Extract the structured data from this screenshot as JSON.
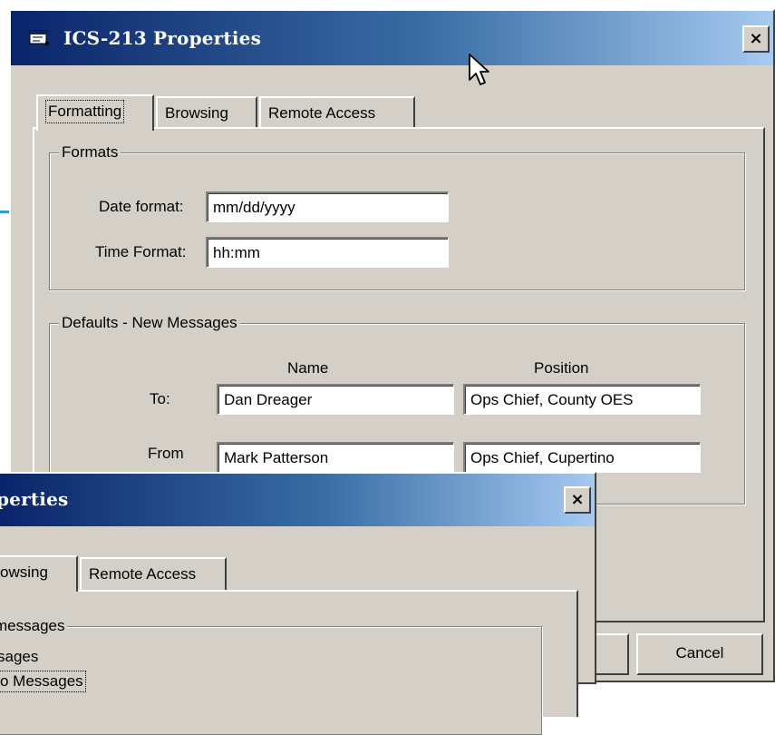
{
  "main_window": {
    "title": "ICS-213 Properties",
    "close_label": "×",
    "tabs": [
      {
        "label": "Formatting",
        "active": true
      },
      {
        "label": "Browsing",
        "active": false
      },
      {
        "label": "Remote Access",
        "active": false
      }
    ],
    "formats_group": {
      "legend": "Formats",
      "date_label": "Date format:",
      "date_value": "mm/dd/yyyy",
      "time_label": "Time Format:",
      "time_value": "hh:mm"
    },
    "defaults_group": {
      "legend": "Defaults - New Messages",
      "col_name": "Name",
      "col_position": "Position",
      "to_label": "To:",
      "to_name": "Dan Dreager",
      "to_position": "Ops Chief, County OES",
      "from_label": "From",
      "from_name": "Mark Patterson",
      "from_position": "Ops Chief, Cupertino"
    },
    "cancel_label": "Cancel"
  },
  "second_window": {
    "title": "perties",
    "close_label": "×",
    "tabs": [
      {
        "label": "owsing",
        "active": true
      },
      {
        "label": "Remote Access",
        "active": false
      }
    ],
    "group_legend": "messages",
    "item_1": "sages",
    "item_2": "o Messages"
  },
  "icons": {
    "app": "window-app-icon",
    "close": "close-icon",
    "cursor": "mouse-pointer-icon"
  },
  "colors": {
    "title_gradient_start": "#0a246a",
    "title_gradient_end": "#a6caf0",
    "face": "#d4d0c8",
    "accent_line": "#2e9ed6"
  }
}
